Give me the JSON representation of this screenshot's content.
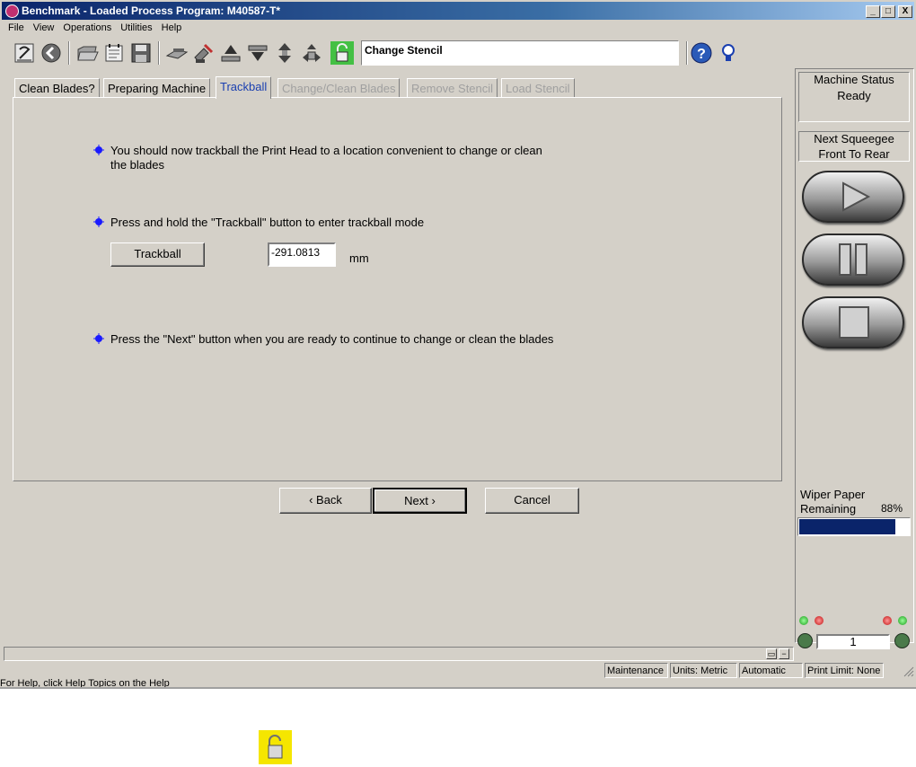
{
  "window": {
    "title": "Benchmark - Loaded Process Program:  M40587-T*",
    "minimize": "_",
    "maximize": "□",
    "close": "X"
  },
  "menu": [
    "File",
    "View",
    "Operations",
    "Utilities",
    "Help"
  ],
  "toolbar": {
    "task_label": "Change Stencil",
    "icons": [
      "home-icon",
      "back-arrow-icon",
      "open-folder-icon",
      "notepad-icon",
      "save-icon",
      "load-board-icon",
      "tools-icon",
      "raise-icon",
      "lower-icon",
      "up-down-arrows-icon",
      "align-icon",
      "padlock-icon",
      "help-icon",
      "lightbulb-icon"
    ]
  },
  "tabs": [
    {
      "label": "Clean Blades?",
      "state": "normal"
    },
    {
      "label": "Preparing Machine",
      "state": "normal"
    },
    {
      "label": "Trackball",
      "state": "active"
    },
    {
      "label": "Change/Clean Blades",
      "state": "disabled"
    },
    {
      "label": "Remove Stencil",
      "state": "disabled"
    },
    {
      "label": "Load Stencil",
      "state": "disabled"
    }
  ],
  "content": {
    "step1": "You should now trackball the Print Head to a location convenient to change or clean the blades",
    "step2": "Press and hold the \"Trackball\" button to enter trackball mode",
    "trackball_button": "Trackball",
    "position_value": "-291.0813",
    "unit": "mm",
    "step3": "Press the \"Next\" button when you are ready to continue to change or clean the blades"
  },
  "nav": {
    "back": "‹ Back",
    "next": "Next ›",
    "cancel": "Cancel"
  },
  "right_panel": {
    "machine_status_title": "Machine Status",
    "machine_status_value": "Ready",
    "next_squeegee_title": "Next Squeegee",
    "next_squeegee_value": "Front To Rear",
    "wiper_title_1": "Wiper Paper",
    "wiper_title_2": "Remaining",
    "wiper_percent_label": "88%",
    "wiper_fraction": 0.88,
    "counter_value": "1"
  },
  "statusbar": {
    "mode": "Maintenance",
    "units": "Units: Metric",
    "operation": "Automatic",
    "print_limit": "Print Limit: None"
  },
  "background_text": "For Help, click Help Topics on the Help Menu",
  "colors": {
    "title_bar": "#0a246a",
    "active_tab": "#1a3fb0",
    "progress": "#0a246a",
    "lock": "#f5e600"
  }
}
